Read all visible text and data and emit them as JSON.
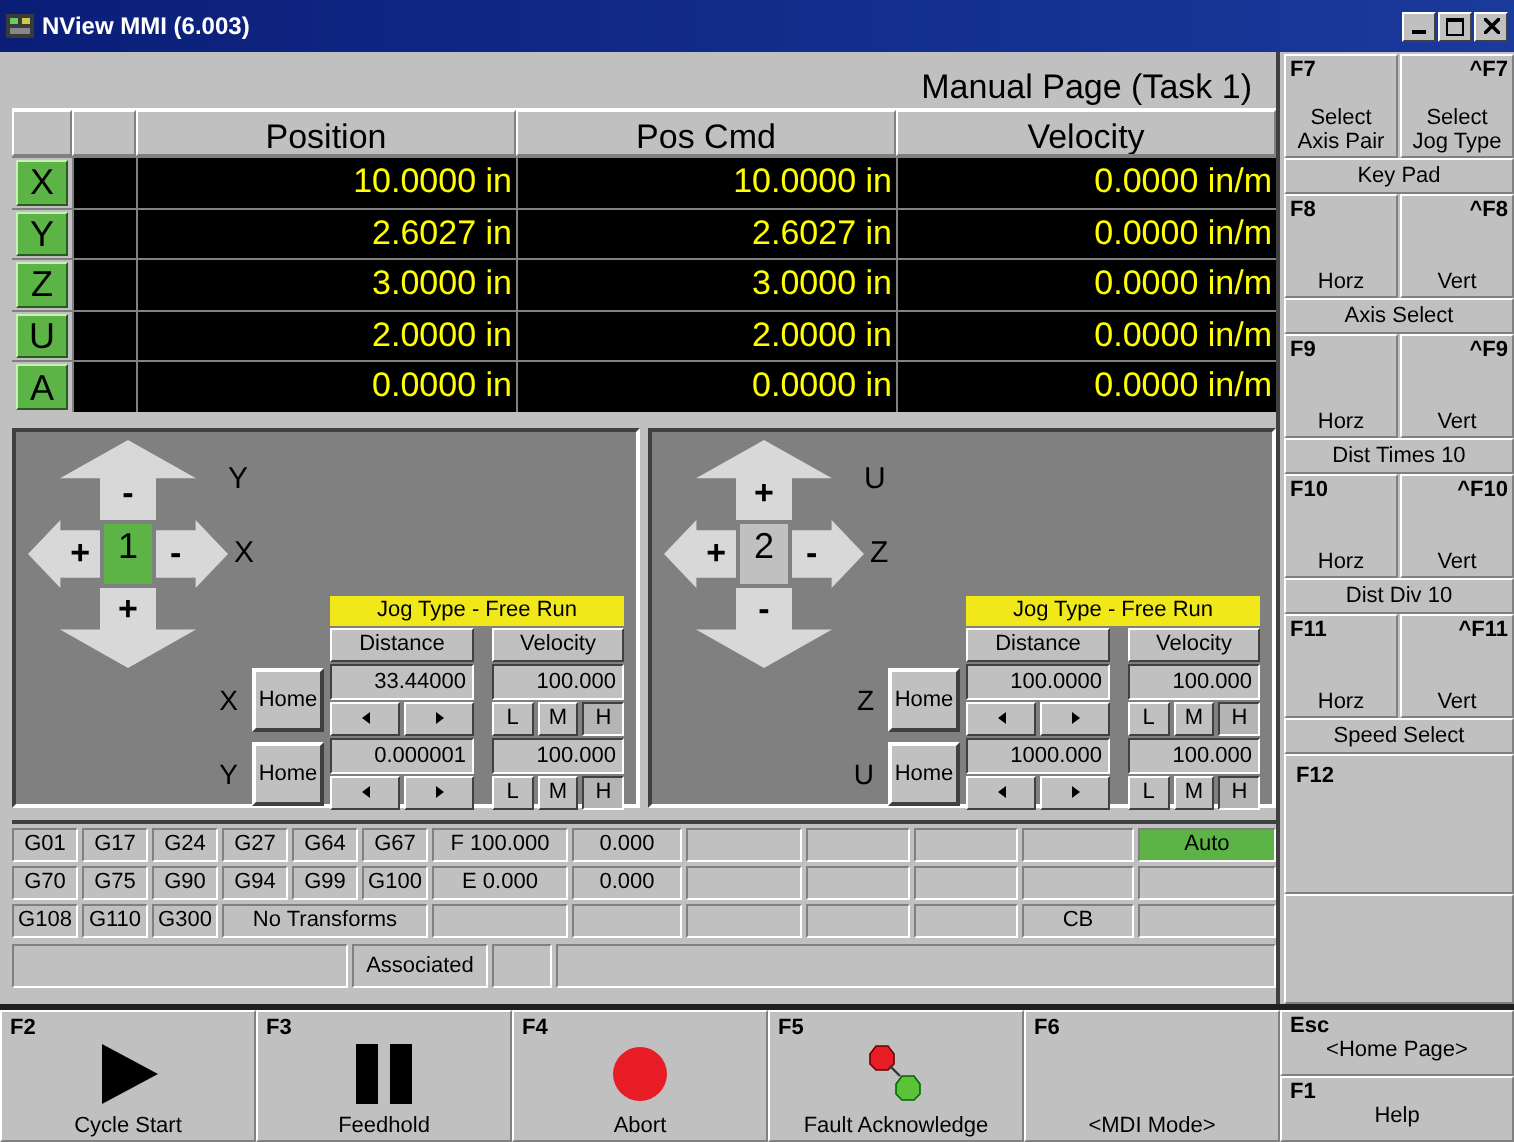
{
  "window": {
    "title": "NView MMI (6.003)"
  },
  "page_title": "Manual Page (Task 1)",
  "table": {
    "columns": [
      "Position",
      "Pos Cmd",
      "Velocity"
    ],
    "rows": [
      {
        "axis": "X",
        "values": [
          "10.0000 in",
          "10.0000 in",
          "0.0000 in/m"
        ]
      },
      {
        "axis": "Y",
        "values": [
          "2.6027 in",
          "2.6027 in",
          "0.0000 in/m"
        ]
      },
      {
        "axis": "Z",
        "values": [
          "3.0000 in",
          "3.0000 in",
          "0.0000 in/m"
        ]
      },
      {
        "axis": "U",
        "values": [
          "2.0000 in",
          "2.0000 in",
          "0.0000 in/m"
        ]
      },
      {
        "axis": "A",
        "values": [
          "0.0000 in",
          "0.0000 in",
          "0.0000 in/m"
        ]
      }
    ]
  },
  "jog_panels": [
    {
      "number": "1",
      "selected": true,
      "arrows": {
        "up": "-",
        "left": "+",
        "right": "-",
        "down": "+"
      },
      "vertical_axis": "Y",
      "horizontal_axis": "X",
      "jog_type": "Jog Type - Free Run",
      "distance_label": "Distance",
      "velocity_label": "Velocity",
      "axes": [
        {
          "name": "X",
          "home": "Home",
          "distance": "33.44000",
          "velocity": "100.000",
          "speeds": [
            {
              "label": "L",
              "selected": false
            },
            {
              "label": "M",
              "selected": false
            },
            {
              "label": "H",
              "selected": true
            }
          ]
        },
        {
          "name": "Y",
          "home": "Home",
          "distance": "0.000001",
          "velocity": "100.000",
          "speeds": [
            {
              "label": "L",
              "selected": false
            },
            {
              "label": "M",
              "selected": false
            },
            {
              "label": "H",
              "selected": true
            }
          ]
        }
      ]
    },
    {
      "number": "2",
      "selected": false,
      "arrows": {
        "up": "+",
        "left": "+",
        "right": "-",
        "down": "-"
      },
      "vertical_axis": "U",
      "horizontal_axis": "Z",
      "jog_type": "Jog Type - Free Run",
      "distance_label": "Distance",
      "velocity_label": "Velocity",
      "axes": [
        {
          "name": "Z",
          "home": "Home",
          "distance": "100.0000",
          "velocity": "100.000",
          "speeds": [
            {
              "label": "L",
              "selected": false
            },
            {
              "label": "M",
              "selected": false
            },
            {
              "label": "H",
              "selected": true
            }
          ]
        },
        {
          "name": "U",
          "home": "Home",
          "distance": "1000.000",
          "velocity": "100.000",
          "speeds": [
            {
              "label": "L",
              "selected": false
            },
            {
              "label": "M",
              "selected": false
            },
            {
              "label": "H",
              "selected": true
            }
          ]
        }
      ]
    }
  ],
  "gcode_rows": [
    [
      {
        "kind": "code",
        "text": "G01",
        "active": false
      },
      {
        "kind": "code",
        "text": "G17",
        "active": false
      },
      {
        "kind": "code",
        "text": "G24",
        "active": false
      },
      {
        "kind": "code",
        "text": "G27",
        "active": false
      },
      {
        "kind": "code",
        "text": "G64",
        "active": false
      },
      {
        "kind": "code",
        "text": "G67",
        "active": false
      },
      {
        "kind": "code",
        "text": "F 100.000",
        "active": false
      },
      {
        "kind": "code",
        "text": "0.000",
        "active": false
      },
      {
        "kind": "blank",
        "active": false
      },
      {
        "kind": "blank",
        "active": false
      },
      {
        "kind": "blank",
        "active": false
      },
      {
        "kind": "blank",
        "active": false
      },
      {
        "kind": "code",
        "text": "Auto",
        "active": true
      }
    ],
    [
      {
        "kind": "code",
        "text": "G70",
        "active": false
      },
      {
        "kind": "code",
        "text": "G75",
        "active": false
      },
      {
        "kind": "code",
        "text": "G90",
        "active": false
      },
      {
        "kind": "code",
        "text": "G94",
        "active": false
      },
      {
        "kind": "code",
        "text": "G99",
        "active": false
      },
      {
        "kind": "code",
        "text": "G100",
        "active": false
      },
      {
        "kind": "code",
        "text": "E 0.000",
        "active": false
      },
      {
        "kind": "code",
        "text": "0.000",
        "active": false
      },
      {
        "kind": "blank",
        "active": false
      },
      {
        "kind": "blank",
        "active": false
      },
      {
        "kind": "blank",
        "active": false
      },
      {
        "kind": "blank",
        "active": false
      },
      {
        "kind": "blank",
        "active": false
      }
    ],
    [
      {
        "kind": "code",
        "text": "G108",
        "active": false
      },
      {
        "kind": "code",
        "text": "G110",
        "active": false
      },
      {
        "kind": "code",
        "text": "G300",
        "active": false
      },
      {
        "kind": "wide",
        "text": "No Transforms",
        "active": false
      },
      {
        "kind": "blank",
        "active": false
      },
      {
        "kind": "blank",
        "active": false
      },
      {
        "kind": "blank",
        "active": false
      },
      {
        "kind": "blank",
        "active": false
      },
      {
        "kind": "blank",
        "active": false
      },
      {
        "kind": "code",
        "text": "CB",
        "active": false
      },
      {
        "kind": "blank",
        "active": false
      }
    ]
  ],
  "status_row": [
    {
      "kind": "wide"
    },
    {
      "kind": "label",
      "text": "Associated"
    },
    {
      "kind": "narrow"
    },
    {
      "kind": "fill"
    }
  ],
  "function_keys": [
    {
      "keys": [
        {
          "key": "F7",
          "label": "Select Axis Pair"
        },
        {
          "key": "^F7",
          "label": "Select Jog Type"
        }
      ],
      "caption": "Key Pad"
    },
    {
      "keys": [
        {
          "key": "F8",
          "label": "Horz"
        },
        {
          "key": "^F8",
          "label": "Vert"
        }
      ],
      "caption": "Axis Select"
    },
    {
      "keys": [
        {
          "key": "F9",
          "label": "Horz"
        },
        {
          "key": "^F9",
          "label": "Vert"
        }
      ],
      "caption": "Dist Times 10"
    },
    {
      "keys": [
        {
          "key": "F10",
          "label": "Horz"
        },
        {
          "key": "^F10",
          "label": "Vert"
        }
      ],
      "caption": "Dist Div 10"
    },
    {
      "keys": [
        {
          "key": "F11",
          "label": "Horz"
        },
        {
          "key": "^F11",
          "label": "Vert"
        }
      ],
      "caption": "Speed Select"
    }
  ],
  "f12": {
    "key": "F12"
  },
  "toolbar": [
    {
      "key": "F2",
      "label": "Cycle Start",
      "kind": "play"
    },
    {
      "key": "F3",
      "label": "Feedhold",
      "kind": "pause"
    },
    {
      "key": "F4",
      "label": "Abort",
      "kind": "stop"
    },
    {
      "key": "F5",
      "label": "Fault Acknowledge",
      "kind": "fault"
    },
    {
      "key": "F6",
      "label": "<MDI Mode>"
    }
  ],
  "esc": {
    "key": "Esc",
    "label": "<Home Page>"
  },
  "help": {
    "key": "F1",
    "label": "Help"
  }
}
